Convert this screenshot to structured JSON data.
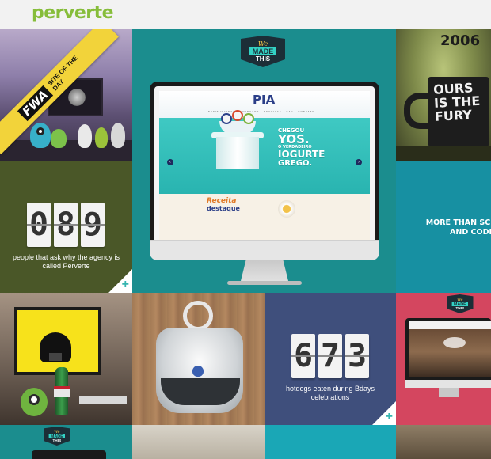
{
  "header": {
    "logo": "perverte"
  },
  "awards": {
    "fwa_logo": "FWA",
    "site_of_the_day": "SITE OF THE DAY"
  },
  "badge": {
    "line1": "We",
    "line2": "MADE",
    "line3": "THIS"
  },
  "showcase": {
    "site_logo": "PIA",
    "nav": "INSTITUCIONAL · PRODUTOS · RECEITAS · SAC · CONTATO",
    "hero_line1": "CHEGOU",
    "hero_line2": "YOS.",
    "hero_line3": "O VERDADEIRO",
    "hero_line4": "IOGURTE",
    "hero_line5": "GREGO.",
    "arrow_left": "‹",
    "arrow_right": "›",
    "receita_line1": "Receita",
    "receita_line2": "destaque"
  },
  "mug_tile": {
    "year": "2006",
    "mug_text": "OURS IS THE FURY"
  },
  "counter1": {
    "digits": [
      "0",
      "8",
      "9"
    ],
    "caption": "people that ask why the agency is called Perverte"
  },
  "counter2": {
    "digits": [
      "6",
      "7",
      "3"
    ],
    "caption": "hotdogs eaten during Bdays celebrations"
  },
  "more_tile": {
    "text": "MORE THAN SCREENS AND CODE"
  },
  "corner": {
    "plus": "+"
  },
  "colors": {
    "logo_green": "#86bd3a",
    "teal": "#1b8d8e",
    "olive": "#4a5728",
    "navy": "#3f4f7c",
    "pink": "#d4465f",
    "blue_teal": "#1790a2"
  }
}
